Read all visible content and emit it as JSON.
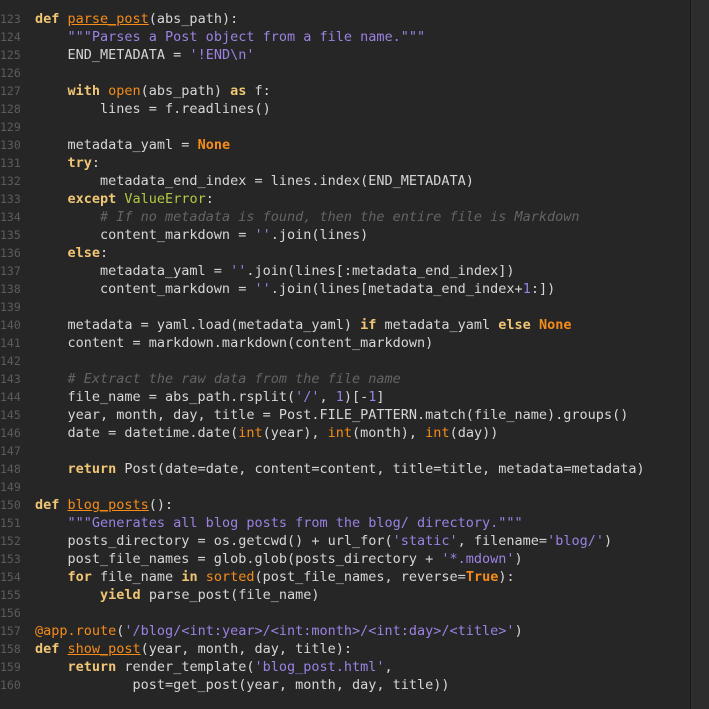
{
  "editor": {
    "colors": {
      "background": "#262626",
      "keyword": "#f0c674",
      "function": "#f58c1a",
      "string": "#9b82e3",
      "comment": "#646464",
      "plain": "#d6d6d6",
      "line_number": "#5c5c5c"
    },
    "lines": [
      {
        "n": "123",
        "tokens": [
          [
            "kw",
            "def "
          ],
          [
            "fn",
            "parse_post"
          ],
          [
            "plain",
            "(abs_path):"
          ]
        ]
      },
      {
        "n": "124",
        "tokens": [
          [
            "plain",
            "    "
          ],
          [
            "str",
            "\"\"\"Parses a Post object from a file name.\"\"\""
          ]
        ]
      },
      {
        "n": "125",
        "tokens": [
          [
            "plain",
            "    END_METADATA = "
          ],
          [
            "str",
            "'!END"
          ],
          [
            "esc",
            "\\n"
          ],
          [
            "str",
            "'"
          ]
        ]
      },
      {
        "n": "126",
        "tokens": []
      },
      {
        "n": "127",
        "tokens": [
          [
            "plain",
            "    "
          ],
          [
            "kw",
            "with "
          ],
          [
            "builtin",
            "open"
          ],
          [
            "plain",
            "(abs_path) "
          ],
          [
            "kw",
            "as "
          ],
          [
            "plain",
            "f:"
          ]
        ]
      },
      {
        "n": "128",
        "tokens": [
          [
            "plain",
            "        lines = f.readlines()"
          ]
        ]
      },
      {
        "n": "129",
        "tokens": []
      },
      {
        "n": "130",
        "tokens": [
          [
            "plain",
            "    metadata_yaml = "
          ],
          [
            "const",
            "None"
          ]
        ]
      },
      {
        "n": "131",
        "tokens": [
          [
            "plain",
            "    "
          ],
          [
            "kw",
            "try"
          ],
          [
            "plain",
            ":"
          ]
        ]
      },
      {
        "n": "132",
        "tokens": [
          [
            "plain",
            "        metadata_end_index = lines.index(END_METADATA)"
          ]
        ]
      },
      {
        "n": "133",
        "tokens": [
          [
            "plain",
            "    "
          ],
          [
            "kw",
            "except "
          ],
          [
            "exc",
            "ValueError"
          ],
          [
            "plain",
            ":"
          ]
        ]
      },
      {
        "n": "134",
        "tokens": [
          [
            "plain",
            "        "
          ],
          [
            "cmt",
            "# If no metadata is found, then the entire file is Markdown"
          ]
        ]
      },
      {
        "n": "135",
        "tokens": [
          [
            "plain",
            "        content_markdown = "
          ],
          [
            "str",
            "''"
          ],
          [
            "plain",
            ".join(lines)"
          ]
        ]
      },
      {
        "n": "136",
        "tokens": [
          [
            "plain",
            "    "
          ],
          [
            "kw",
            "else"
          ],
          [
            "plain",
            ":"
          ]
        ]
      },
      {
        "n": "137",
        "tokens": [
          [
            "plain",
            "        metadata_yaml = "
          ],
          [
            "str",
            "''"
          ],
          [
            "plain",
            ".join(lines[:metadata_end_index])"
          ]
        ]
      },
      {
        "n": "138",
        "tokens": [
          [
            "plain",
            "        content_markdown = "
          ],
          [
            "str",
            "''"
          ],
          [
            "plain",
            ".join(lines[metadata_end_index+"
          ],
          [
            "num",
            "1"
          ],
          [
            "plain",
            ":])"
          ]
        ]
      },
      {
        "n": "139",
        "tokens": []
      },
      {
        "n": "140",
        "tokens": [
          [
            "plain",
            "    metadata = yaml.load(metadata_yaml) "
          ],
          [
            "kw",
            "if "
          ],
          [
            "plain",
            "metadata_yaml "
          ],
          [
            "kw",
            "else "
          ],
          [
            "const",
            "None"
          ]
        ]
      },
      {
        "n": "141",
        "tokens": [
          [
            "plain",
            "    content = markdown.markdown(content_markdown)"
          ]
        ]
      },
      {
        "n": "142",
        "tokens": []
      },
      {
        "n": "143",
        "tokens": [
          [
            "plain",
            "    "
          ],
          [
            "cmt",
            "# Extract the raw data from the file name"
          ]
        ]
      },
      {
        "n": "144",
        "tokens": [
          [
            "plain",
            "    file_name = abs_path.rsplit("
          ],
          [
            "str",
            "'/'"
          ],
          [
            "plain",
            ", "
          ],
          [
            "num",
            "1"
          ],
          [
            "plain",
            ")[-"
          ],
          [
            "num",
            "1"
          ],
          [
            "plain",
            "]"
          ]
        ]
      },
      {
        "n": "145",
        "tokens": [
          [
            "plain",
            "    year, month, day, title = Post.FILE_PATTERN.match(file_name).groups()"
          ]
        ]
      },
      {
        "n": "146",
        "tokens": [
          [
            "plain",
            "    date = datetime.date("
          ],
          [
            "builtin",
            "int"
          ],
          [
            "plain",
            "(year), "
          ],
          [
            "builtin",
            "int"
          ],
          [
            "plain",
            "(month), "
          ],
          [
            "builtin",
            "int"
          ],
          [
            "plain",
            "(day))"
          ]
        ]
      },
      {
        "n": "147",
        "tokens": []
      },
      {
        "n": "148",
        "tokens": [
          [
            "plain",
            "    "
          ],
          [
            "kw",
            "return "
          ],
          [
            "plain",
            "Post(date=date, content=content, title=title, metadata=metadata)"
          ]
        ]
      },
      {
        "n": "149",
        "tokens": []
      },
      {
        "n": "150",
        "tokens": [
          [
            "kw",
            "def "
          ],
          [
            "fn",
            "blog_posts"
          ],
          [
            "plain",
            "():"
          ]
        ]
      },
      {
        "n": "151",
        "tokens": [
          [
            "plain",
            "    "
          ],
          [
            "str",
            "\"\"\"Generates all blog posts from the blog/ directory.\"\"\""
          ]
        ]
      },
      {
        "n": "152",
        "tokens": [
          [
            "plain",
            "    posts_directory = os.getcwd() + url_for("
          ],
          [
            "str",
            "'static'"
          ],
          [
            "plain",
            ", filename="
          ],
          [
            "str",
            "'blog/'"
          ],
          [
            "plain",
            ")"
          ]
        ]
      },
      {
        "n": "153",
        "tokens": [
          [
            "plain",
            "    post_file_names = glob.glob(posts_directory + "
          ],
          [
            "str",
            "'*.mdown'"
          ],
          [
            "plain",
            ")"
          ]
        ]
      },
      {
        "n": "154",
        "tokens": [
          [
            "plain",
            "    "
          ],
          [
            "kw",
            "for "
          ],
          [
            "plain",
            "file_name "
          ],
          [
            "kw",
            "in "
          ],
          [
            "builtin",
            "sorted"
          ],
          [
            "plain",
            "(post_file_names, reverse="
          ],
          [
            "const",
            "True"
          ],
          [
            "plain",
            "):"
          ]
        ]
      },
      {
        "n": "155",
        "tokens": [
          [
            "plain",
            "        "
          ],
          [
            "kw",
            "yield "
          ],
          [
            "plain",
            "parse_post(file_name)"
          ]
        ]
      },
      {
        "n": "156",
        "tokens": []
      },
      {
        "n": "157",
        "tokens": [
          [
            "dec",
            "@app.route"
          ],
          [
            "plain",
            "("
          ],
          [
            "str",
            "'/blog/<int:year>/<int:month>/<int:day>/<title>'"
          ],
          [
            "plain",
            ")"
          ]
        ]
      },
      {
        "n": "158",
        "tokens": [
          [
            "kw",
            "def "
          ],
          [
            "fn",
            "show_post"
          ],
          [
            "plain",
            "(year, month, day, title):"
          ]
        ]
      },
      {
        "n": "159",
        "tokens": [
          [
            "plain",
            "    "
          ],
          [
            "kw",
            "return "
          ],
          [
            "plain",
            "render_template("
          ],
          [
            "str",
            "'blog_post.html'"
          ],
          [
            "plain",
            ","
          ]
        ]
      },
      {
        "n": "160",
        "tokens": [
          [
            "plain",
            "            post=get_post(year, month, day, title))"
          ]
        ]
      }
    ]
  }
}
